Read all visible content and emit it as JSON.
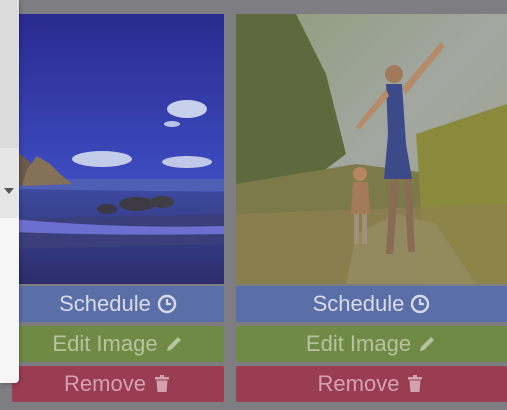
{
  "cards": [
    {
      "image_alt": "Beach at twilight",
      "schedule_label": "Schedule",
      "edit_label": "Edit Image",
      "remove_label": "Remove"
    },
    {
      "image_alt": "Parent and child walking in meadow",
      "schedule_label": "Schedule",
      "edit_label": "Edit Image",
      "remove_label": "Remove"
    }
  ],
  "icons": {
    "schedule": "clock-icon",
    "edit": "pencil-icon",
    "remove": "trash-icon"
  },
  "colors": {
    "overlay": "#7d7d82",
    "schedule": "#5a6ea8",
    "edit": "#6f8a45",
    "remove": "#9a3d53"
  }
}
